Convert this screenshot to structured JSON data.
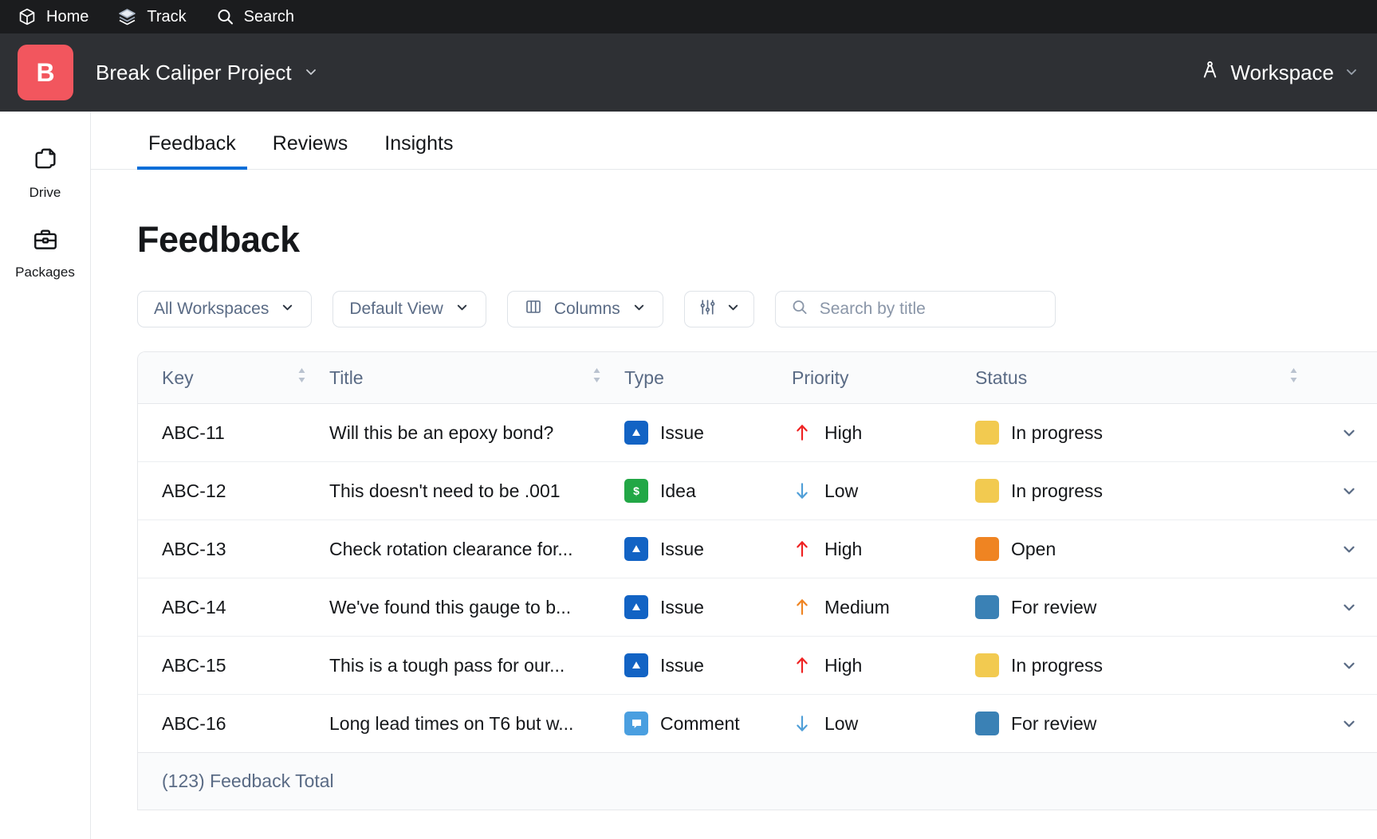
{
  "topnav": {
    "items": [
      {
        "label": "Home",
        "icon": "cube-icon"
      },
      {
        "label": "Track",
        "icon": "layers-icon"
      },
      {
        "label": "Search",
        "icon": "search-icon"
      }
    ]
  },
  "header": {
    "avatar_letter": "B",
    "avatar_color": "#f2565e",
    "project_name": "Break Caliper Project",
    "workspace_label": "Workspace",
    "workspace_icon": "compass-icon"
  },
  "sidebar": {
    "items": [
      {
        "label": "Drive",
        "icon": "documents-icon"
      },
      {
        "label": "Packages",
        "icon": "briefcase-icon"
      }
    ]
  },
  "tabs": [
    {
      "label": "Feedback",
      "active": true
    },
    {
      "label": "Reviews",
      "active": false
    },
    {
      "label": "Insights",
      "active": false
    }
  ],
  "page": {
    "title": "Feedback",
    "accent_color": "#0b6ed8"
  },
  "toolbar": {
    "workspace_filter": "All Workspaces",
    "view_filter": "Default View",
    "columns_label": "Columns",
    "settings_icon": "sliders-icon",
    "search_placeholder": "Search by title",
    "search_value": ""
  },
  "table": {
    "columns": [
      {
        "label": "Key",
        "sortable": true
      },
      {
        "label": "Title",
        "sortable": true
      },
      {
        "label": "Type",
        "sortable": false
      },
      {
        "label": "Priority",
        "sortable": false
      },
      {
        "label": "Status",
        "sortable": true
      }
    ],
    "rows": [
      {
        "key": "ABC-11",
        "title": "Will this be an epoxy bond?",
        "type": "Issue",
        "type_icon": "triangle-icon",
        "type_color": "#1263c4",
        "priority": "High",
        "priority_icon": "arrow-up-icon",
        "priority_color": "#ef2222",
        "status": "In progress",
        "status_color": "#f2ca50"
      },
      {
        "key": "ABC-12",
        "title": "This doesn't need to be .001",
        "type": "Idea",
        "type_icon": "dollar-icon",
        "type_color": "#22a746",
        "priority": "Low",
        "priority_icon": "arrow-down-icon",
        "priority_color": "#4f9fd8",
        "status": "In progress",
        "status_color": "#f2ca50"
      },
      {
        "key": "ABC-13",
        "title": "Check rotation clearance for...",
        "type": "Issue",
        "type_icon": "triangle-icon",
        "type_color": "#1263c4",
        "priority": "High",
        "priority_icon": "arrow-up-icon",
        "priority_color": "#ef2222",
        "status": "Open",
        "status_color": "#ef8422"
      },
      {
        "key": "ABC-14",
        "title": "We've found this gauge to b...",
        "type": "Issue",
        "type_icon": "triangle-icon",
        "type_color": "#1263c4",
        "priority": "Medium",
        "priority_icon": "arrow-up-icon",
        "priority_color": "#ef8422",
        "status": "For review",
        "status_color": "#3a81b5"
      },
      {
        "key": "ABC-15",
        "title": "This is a tough pass for our...",
        "type": "Issue",
        "type_icon": "triangle-icon",
        "type_color": "#1263c4",
        "priority": "High",
        "priority_icon": "arrow-up-icon",
        "priority_color": "#ef2222",
        "status": "In progress",
        "status_color": "#f2ca50"
      },
      {
        "key": "ABC-16",
        "title": "Long lead times on T6 but w...",
        "type": "Comment",
        "type_icon": "comment-icon",
        "type_color": "#4a9fe0",
        "priority": "Low",
        "priority_icon": "arrow-down-icon",
        "priority_color": "#4f9fd8",
        "status": "For review",
        "status_color": "#3a81b5"
      }
    ],
    "footer_total": "(123) Feedback Total"
  }
}
